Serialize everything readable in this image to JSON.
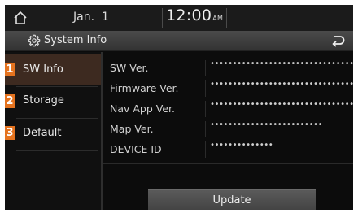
{
  "status_bar": {
    "date": "Jan.  1",
    "time": "12:00",
    "ampm": "AM"
  },
  "header": {
    "title": "System Info",
    "icon": "gear-icon",
    "back_icon": "back-icon"
  },
  "sidebar": {
    "items": [
      {
        "number": "1",
        "label": "SW Info",
        "selected": true
      },
      {
        "number": "2",
        "label": "Storage",
        "selected": false
      },
      {
        "number": "3",
        "label": "Default",
        "selected": false
      }
    ]
  },
  "info": {
    "rows": [
      {
        "label": "SW Ver.",
        "value": "••••••••••••••••••••••••••••••••••"
      },
      {
        "label": "Firmware Ver.",
        "value": "••••••••••••••••••••••••••••••••••"
      },
      {
        "label": "Nav App Ver.",
        "value": "••••••••••••••••••••••••••••••••••"
      },
      {
        "label": "Map Ver.",
        "value": "•••••••••••••••••••••••••"
      },
      {
        "label": "DEVICE ID",
        "value": "••••••••••••••"
      }
    ]
  },
  "update_button": {
    "label": "Update"
  },
  "colors": {
    "accent": "#e5731f",
    "selected_bg": "#3d2a20",
    "background": "#0c0c0c"
  }
}
